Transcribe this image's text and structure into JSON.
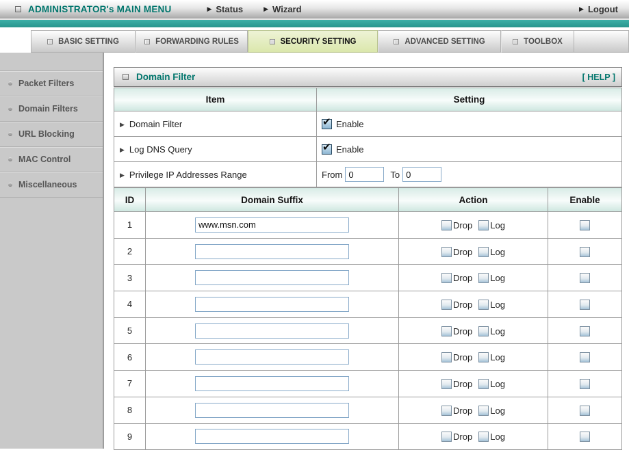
{
  "colors": {
    "accent_teal": "#2E9E96",
    "brand_text_teal": "#00756C",
    "tab_active_bg": "#DBE7AC",
    "sidebar_bg": "#C9C9C9",
    "checkbox_blue": "#A5C3D8",
    "table_header_tint": "#D9ECE7"
  },
  "top_menu": {
    "title": "ADMINISTRATOR's MAIN MENU",
    "status_label": "Status",
    "wizard_label": "Wizard",
    "logout_label": "Logout",
    "arrow_glyph": "▶"
  },
  "tabs": [
    {
      "label": "BASIC SETTING",
      "active": false
    },
    {
      "label": "FORWARDING RULES",
      "active": false
    },
    {
      "label": "SECURITY SETTING",
      "active": true
    },
    {
      "label": "ADVANCED SETTING",
      "active": false
    },
    {
      "label": "TOOLBOX",
      "active": false
    }
  ],
  "sidebar": {
    "items": [
      {
        "label": "Packet Filters"
      },
      {
        "label": "Domain Filters"
      },
      {
        "label": "URL Blocking"
      },
      {
        "label": "MAC Control"
      },
      {
        "label": "Miscellaneous"
      }
    ]
  },
  "main": {
    "panel_title": "Domain Filter",
    "help_label": "[ HELP ]",
    "settings_table": {
      "headers": {
        "item": "Item",
        "setting": "Setting"
      },
      "rows": [
        {
          "label": "Domain Filter",
          "checkbox_label": "Enable",
          "checked": true
        },
        {
          "label": "Log DNS Query",
          "checkbox_label": "Enable",
          "checked": true
        },
        {
          "label": "Privilege IP Addresses Range",
          "from_label": "From",
          "from_value": "0",
          "to_label": "To",
          "to_value": "0"
        }
      ]
    },
    "domain_table": {
      "headers": {
        "id": "ID",
        "suffix": "Domain Suffix",
        "action": "Action",
        "enable": "Enable"
      },
      "action_labels": {
        "drop": "Drop",
        "log": "Log"
      },
      "rows": [
        {
          "id": "1",
          "domain": "www.msn.com",
          "drop": false,
          "log": false,
          "enable": false
        },
        {
          "id": "2",
          "domain": "",
          "drop": false,
          "log": false,
          "enable": false
        },
        {
          "id": "3",
          "domain": "",
          "drop": false,
          "log": false,
          "enable": false
        },
        {
          "id": "4",
          "domain": "",
          "drop": false,
          "log": false,
          "enable": false
        },
        {
          "id": "5",
          "domain": "",
          "drop": false,
          "log": false,
          "enable": false
        },
        {
          "id": "6",
          "domain": "",
          "drop": false,
          "log": false,
          "enable": false
        },
        {
          "id": "7",
          "domain": "",
          "drop": false,
          "log": false,
          "enable": false
        },
        {
          "id": "8",
          "domain": "",
          "drop": false,
          "log": false,
          "enable": false
        },
        {
          "id": "9",
          "domain": "",
          "drop": false,
          "log": false,
          "enable": false
        }
      ]
    }
  }
}
